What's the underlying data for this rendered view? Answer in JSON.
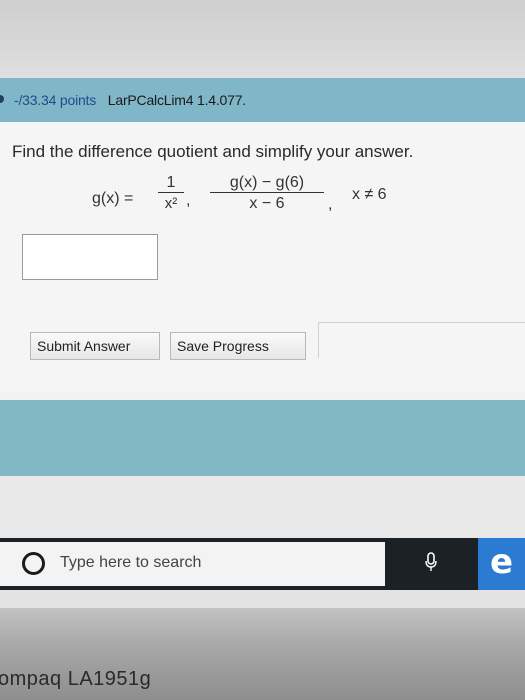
{
  "header": {
    "points_prefix": "-/33.34",
    "points_label": "points",
    "problem_id": "LarPCalcLim4 1.4.077."
  },
  "question": {
    "text": "Find the difference quotient and simplify your answer.",
    "function_lhs": "g(x) =",
    "fraction1_numerator": "1",
    "fraction1_denominator": "x²",
    "fraction2_numerator": "g(x) − g(6)",
    "fraction2_denominator": "x − 6",
    "condition": "x ≠ 6",
    "comma": ","
  },
  "buttons": {
    "submit_label": "Submit Answer",
    "save_label": "Save Progress"
  },
  "taskbar": {
    "search_placeholder": "Type here to search",
    "edge_glyph": "e",
    "mic_glyph": "🎙"
  },
  "bezel": {
    "brand_text": "ompaq LA1951g"
  }
}
